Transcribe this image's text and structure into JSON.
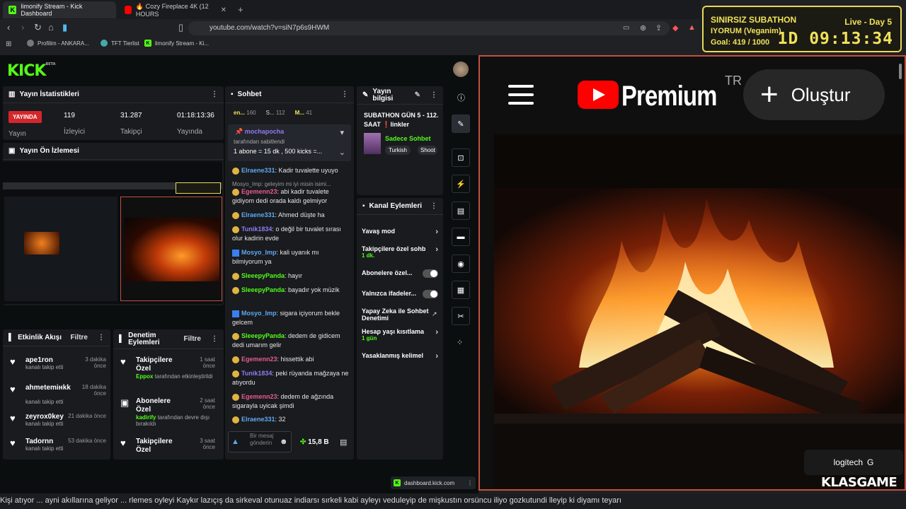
{
  "browser": {
    "tabs": [
      {
        "title": "limonify Stream - Kick Dashboard"
      },
      {
        "title": "🔥 Cozy Fireplace 4K (12 HOURS"
      }
    ],
    "url": "youtube.com/watch?v=siN7p6s9HWM",
    "bookmarks": [
      "Profilim - ANKARA...",
      "TFT Tierlist",
      "limonify Stream - Ki..."
    ]
  },
  "subathon": {
    "title": "SINIRSIZ SUBATHON",
    "subtitle": "IYORUM (Veganim)",
    "goal": "Goal: 419 / 1000",
    "live_day": "Live - Day 5",
    "timer": "1D 09:13:34"
  },
  "dashboard": {
    "logo": "KICK",
    "logo_beta": "BETA",
    "stats": {
      "title": "Yayın İstatistikleri",
      "live_badge": "YAYINDA",
      "live_label": "Yayın",
      "viewers": "119",
      "viewers_label": "İzleyici",
      "followers": "31.287",
      "followers_label": "Takipçi",
      "uptime": "01:18:13:36",
      "uptime_label": "Yayında"
    },
    "preview_title": "Yayın Ön İzlemesi",
    "activity": {
      "title": "Etkinlik Akışı",
      "filter": "Filtre",
      "items": [
        {
          "name": "ape1ron",
          "sub": "kanalı takip etti",
          "time": "3 dakika önce"
        },
        {
          "name": "ahmetemінkk",
          "sub": "kanalı takip etti",
          "time": "18 dakika önce"
        },
        {
          "name": "zeyrox0key",
          "sub": "kanalı takip etti",
          "time": "21 dakika önce"
        },
        {
          "name": "Tadornn",
          "sub": "kanalı takip etti",
          "time": "53 dakika önce"
        }
      ]
    },
    "moderation": {
      "title": "Denetim Eylemleri",
      "filter": "Filtre",
      "items": [
        {
          "name": "Takipçilere Özel",
          "by": "Eppox",
          "sub": "tarafından etkinleştirildi",
          "time": "1 saat önce"
        },
        {
          "name": "Abonelere Özel",
          "by": "kadirify",
          "sub": "tarafından devre dışı bırakıldı",
          "time": "2 saat önce"
        },
        {
          "name": "Takipçilere Özel",
          "by": "",
          "sub": "",
          "time": "3 saat önce"
        }
      ]
    },
    "chat": {
      "title": "Sohbet",
      "top_users": [
        {
          "name": "en...",
          "count": "160"
        },
        {
          "name": "S...",
          "count": "112"
        },
        {
          "name": "M...",
          "count": "41"
        }
      ],
      "pinned_user": "mochapocha",
      "pinned_by": "tarafından sabitlendi",
      "pinned_text": "1 abone = 15 dk , 500 kicks =...",
      "messages": [
        {
          "user": "Elraene331",
          "text": ": Kadir tuvalette uyuyo"
        },
        {
          "user": "Mosyo_Imp",
          "text": ": geleyim mi iyi misin isimi..."
        },
        {
          "user": "Egemenn23",
          "text": ": abi kadir tuvalete gidiyom dedi orada kaldı gelmiyor"
        },
        {
          "user": "Elraene331",
          "text": ": Ahmed düşte ha"
        },
        {
          "user": "Tunik1834",
          "text": ": o değil bir tuvalet sırası olur kadirin evde"
        },
        {
          "user": "Mosyo_Imp",
          "text": ": kali uyanık mı bilmiyorum ya"
        },
        {
          "user": "SleeepyPanda",
          "text": ": hayır"
        },
        {
          "user": "SleeepyPanda",
          "text": ": bayadır yok müzik"
        },
        {
          "user": "Mosyo_Imp",
          "text": ": sigara içiyorum bekle gelcem"
        },
        {
          "user": "SleeepyPanda",
          "text": ": dedem de gidicem dedi umarım gelir"
        },
        {
          "user": "Egemenn23",
          "text": ": hissettik abi"
        },
        {
          "user": "Tunik1834",
          "text": ": peki rüyanda mağzaya ne atıyordu"
        },
        {
          "user": "Egemenn23",
          "text": ": dedem de ağzında sigarayla uyicak şimdi"
        },
        {
          "user": "Elraene331",
          "text": ": 32"
        }
      ],
      "input_placeholder": "Bir mesaj gönderin",
      "kicks": "15,8 B"
    },
    "stream_info": {
      "title": "Yayın bilgisi",
      "stream_title": "SUBATHON GÜN 5 - 112. SAAT ❗linkler",
      "category": "Sadece Sohbet",
      "tags": [
        "Turkish",
        "Shoot"
      ]
    },
    "channel_actions": {
      "title": "Kanal Eylemleri",
      "items": [
        {
          "label": "Yavaş mod"
        },
        {
          "label": "Takipçilere özel sohb",
          "sub": "1 dk."
        },
        {
          "label": "Abonelere özel..."
        },
        {
          "label": "Yalnızca ifadeler..."
        },
        {
          "label": "Yapay Zeka ile Sohbet Denetimi"
        },
        {
          "label": "Hesap yaşı kısıtlama",
          "sub": "1 gün"
        },
        {
          "label": "Yasaklanmış kelimel"
        }
      ]
    },
    "dashboard_url": "dashboard.kick.com"
  },
  "youtube": {
    "premium": "Premium",
    "region": "TR",
    "create": "Oluştur",
    "logitech": "logitech"
  },
  "overlay": {
    "brand_a": "KLAS",
    "brand_b": "GAME",
    "ticker": "Kişi atıyor ... ayni akıllarına geliyor ... rlemes oyleyi Kaykır lazıçış da sirkeval otunuaz indiarsı sırkeli kabi ayleyı veduleyip de mişkustın orsüncu iliyo gozkutundi lleyip ki diyamı teyarı"
  },
  "colors": {
    "kick_green": "#53fc18",
    "live_red": "#d4272b",
    "subathon_yellow": "#f2e15a",
    "yt_red": "#ff0000"
  }
}
